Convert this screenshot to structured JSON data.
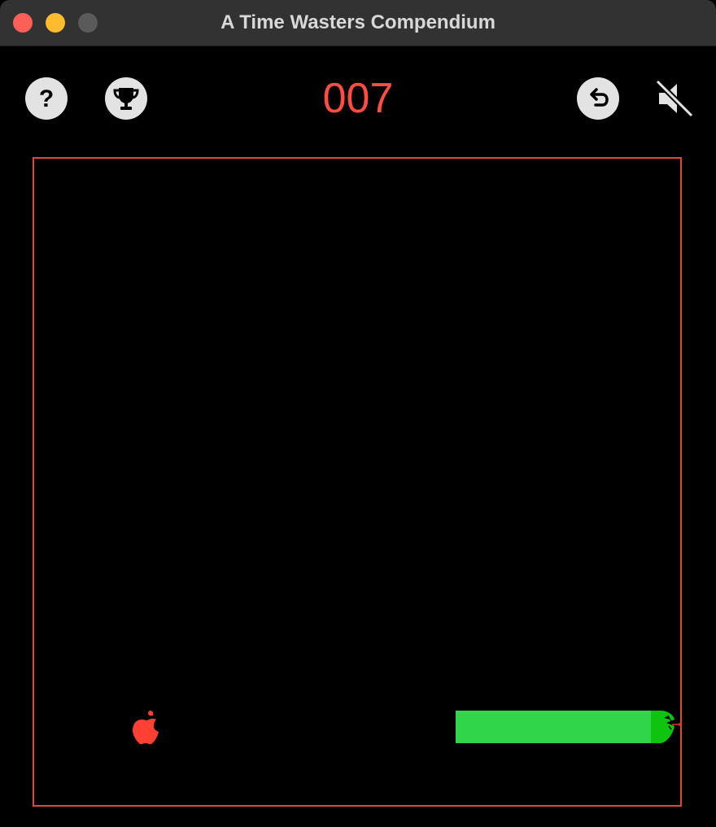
{
  "window": {
    "title": "A Time Wasters Compendium",
    "traffic_lights": [
      "close",
      "minimize",
      "zoom"
    ]
  },
  "toolbar": {
    "help_icon": "question-mark-icon",
    "trophy_icon": "trophy-icon",
    "score": "007",
    "undo_icon": "undo-arrow-icon",
    "sound_icon": "speaker-muted-icon"
  },
  "game": {
    "apple_icon": "red-apple-icon",
    "snake_head_icon": "snake-head-icon",
    "colors": {
      "score": "#ff4d44",
      "border": "#e0473d",
      "snake": "#30d54a",
      "apple": "#ff4033",
      "background": "#000000"
    }
  }
}
